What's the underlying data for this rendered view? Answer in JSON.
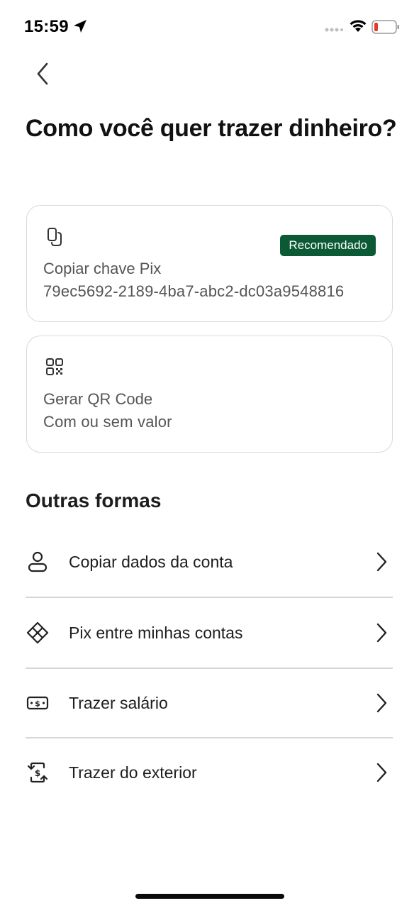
{
  "status": {
    "time": "15:59",
    "battery_color": "#e33b2e"
  },
  "page": {
    "title": "Como você quer trazer dinheiro?"
  },
  "cards": [
    {
      "icon": "copy-icon",
      "badge": "Recomendado",
      "line1": "Copiar chave Pix",
      "line2": "79ec5692-2189-4ba7-abc2-dc03a9548816"
    },
    {
      "icon": "qr-code-icon",
      "line1": "Gerar QR Code",
      "line2": "Com ou sem valor"
    }
  ],
  "other": {
    "title": "Outras formas",
    "items": [
      {
        "icon": "user-icon",
        "label": "Copiar dados da conta"
      },
      {
        "icon": "pix-icon",
        "label": "Pix entre minhas contas"
      },
      {
        "icon": "money-icon",
        "label": "Trazer salário"
      },
      {
        "icon": "exchange-money-icon",
        "label": "Trazer do exterior"
      }
    ]
  },
  "colors": {
    "badge_background": "#0b5a35",
    "card_border": "#d9d9d9",
    "text_secondary": "#555555"
  }
}
